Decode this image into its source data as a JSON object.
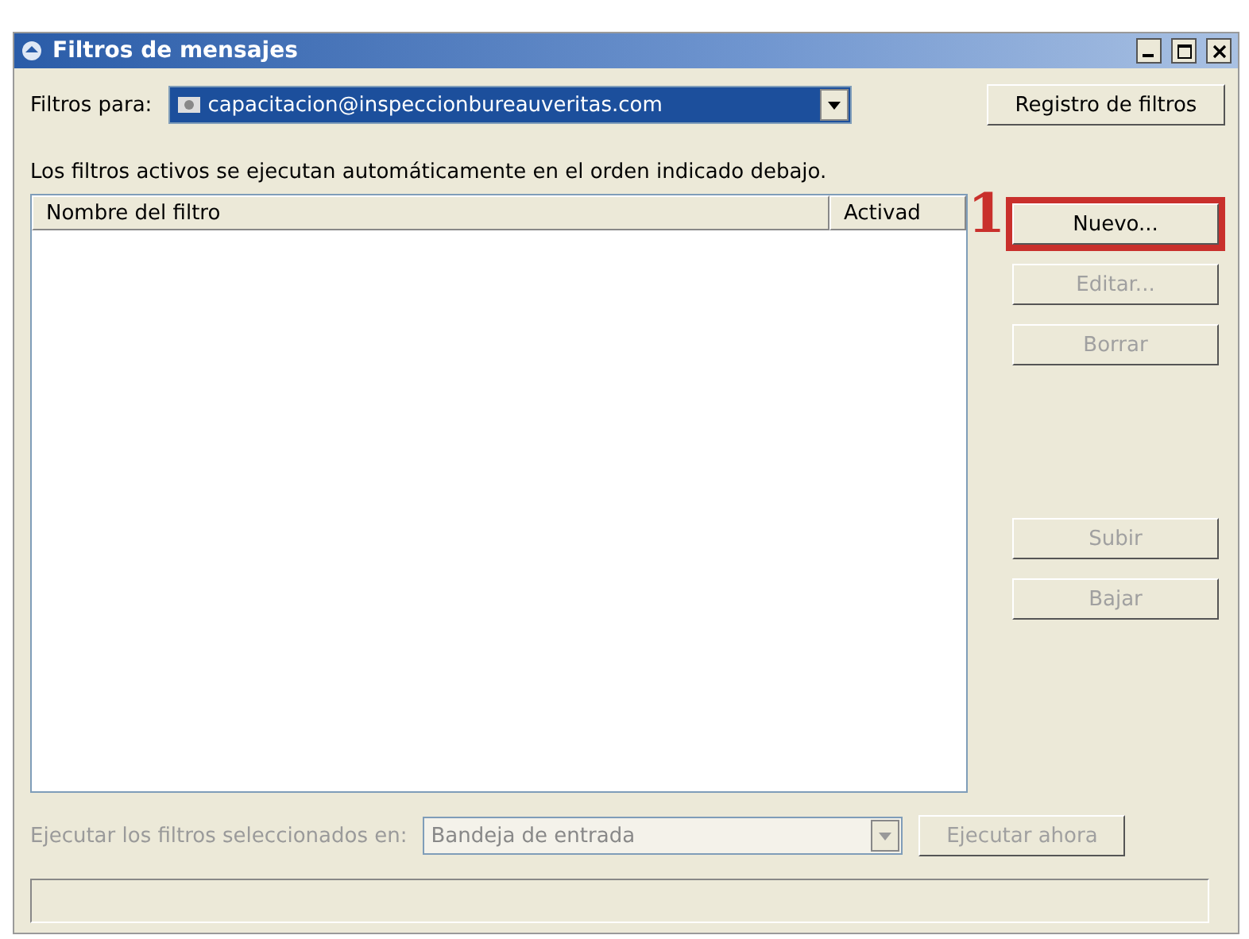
{
  "window": {
    "title": "Filtros de mensajes"
  },
  "filters_for": {
    "label": "Filtros para:",
    "account": "capacitacion@inspeccionbureauveritas.com",
    "selected": true
  },
  "log_button": {
    "label": "Registro de filtros"
  },
  "description": "Los filtros activos se ejecutan automáticamente en el orden indicado debajo.",
  "list": {
    "columns": [
      "Nombre del filtro",
      "Activad"
    ]
  },
  "annotation": "1",
  "edit_buttons": [
    {
      "label": "Nuevo...",
      "disabled": false,
      "highlighted": true
    },
    {
      "label": "Editar...",
      "disabled": true,
      "highlighted": false
    },
    {
      "label": "Borrar",
      "disabled": true,
      "highlighted": false
    }
  ],
  "move_buttons": [
    {
      "label": "Subir",
      "disabled": true,
      "highlighted": false
    },
    {
      "label": "Bajar",
      "disabled": true,
      "highlighted": false
    }
  ],
  "run_row": {
    "label": "Ejecutar los filtros seleccionados en:",
    "folder": "Bandeja de entrada",
    "button": "Ejecutar ahora",
    "disabled": true
  }
}
